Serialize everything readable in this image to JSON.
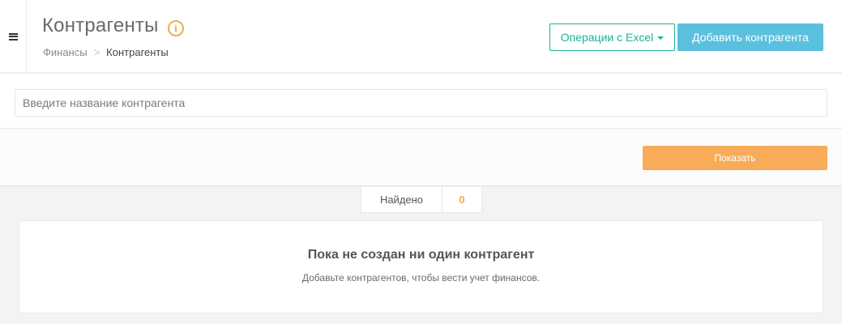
{
  "header": {
    "title": "Контрагенты",
    "breadcrumb": {
      "parent": "Финансы",
      "separator": ">",
      "current": "Контрагенты"
    },
    "excel_button_label": "Операции с Excel",
    "add_button_label": "Добавить контрагента"
  },
  "search": {
    "placeholder": "Введите название контрагента",
    "value": ""
  },
  "filter": {
    "show_button_label": "Показать"
  },
  "results": {
    "found_label": "Найдено",
    "found_count": "0"
  },
  "empty_state": {
    "title": "Пока не создан ни один контрагент",
    "subtitle": "Добавьте контрагентов, чтобы вести учет финансов."
  },
  "icons": {
    "menu": "hamburger-icon",
    "info": "info-icon",
    "dropdown": "caret-down-icon"
  },
  "colors": {
    "primary": "#1ab394",
    "info": "#5bc0de",
    "warning": "#f8ac59",
    "accent_orange": "#f0ad4e"
  }
}
